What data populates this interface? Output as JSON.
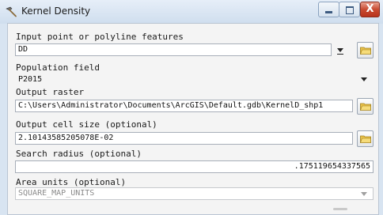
{
  "window": {
    "title": "Kernel Density",
    "close_glyph": "X",
    "title_icon": "hammer-icon"
  },
  "form": {
    "input_features": {
      "label": "Input point or polyline features",
      "value": "DD"
    },
    "population_field": {
      "label": "Population field",
      "value": "P2015"
    },
    "output_raster": {
      "label": "Output raster",
      "value": "C:\\Users\\Administrator\\Documents\\ArcGIS\\Default.gdb\\KernelD_shp1"
    },
    "cell_size": {
      "label": "Output cell size (optional)",
      "value": "2.10143585205078E-02"
    },
    "search_radius": {
      "label": "Search radius (optional)",
      "value": ".175119654337565"
    },
    "area_units": {
      "label": "Area units (optional)",
      "value": "SQUARE_MAP_UNITS"
    }
  },
  "colors": {
    "frame": "#d8e4f1",
    "client": "#f4f4f4",
    "close_button": "#c84a31"
  }
}
